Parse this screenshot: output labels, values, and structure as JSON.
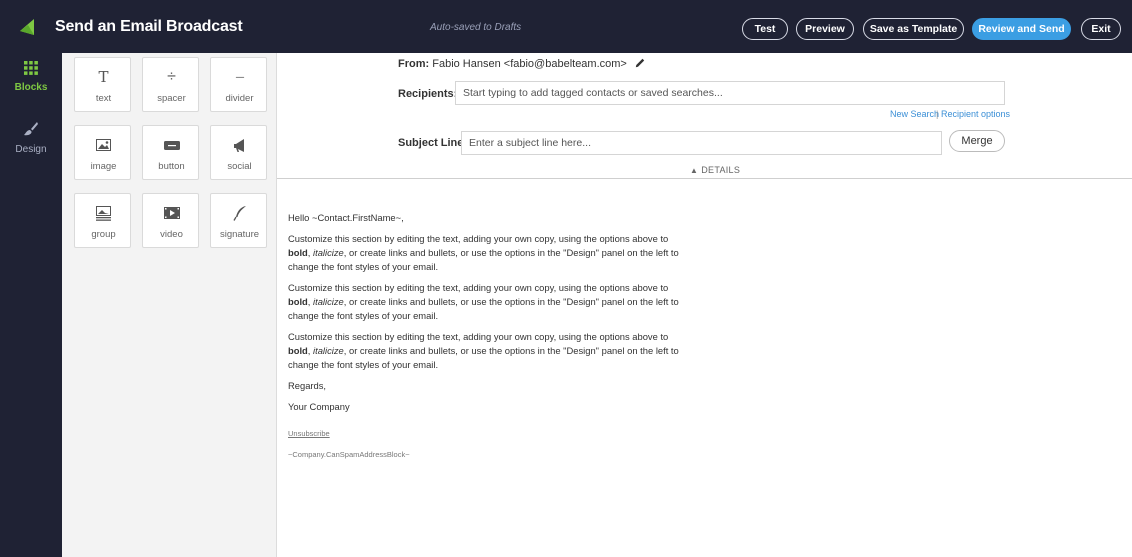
{
  "header": {
    "title": "Send an Email Broadcast",
    "autosave": "Auto-saved to Drafts",
    "buttons": {
      "test": "Test",
      "preview": "Preview",
      "save_template": "Save as Template",
      "review_send": "Review and Send",
      "exit": "Exit"
    },
    "accent": "#3b9ee3"
  },
  "rail": {
    "items": [
      {
        "label": "Blocks",
        "icon": "grid-icon",
        "active": true
      },
      {
        "label": "Design",
        "icon": "paint-brush-icon",
        "active": false
      }
    ],
    "accent": "#7ec843"
  },
  "blocks": {
    "items": [
      {
        "label": "text",
        "icon": "text-icon",
        "glyph": "T"
      },
      {
        "label": "spacer",
        "icon": "spacer-icon",
        "glyph": "÷"
      },
      {
        "label": "divider",
        "icon": "divider-icon",
        "glyph": "----"
      },
      {
        "label": "image",
        "icon": "image-icon",
        "glyph": ""
      },
      {
        "label": "button",
        "icon": "button-icon",
        "glyph": ""
      },
      {
        "label": "social",
        "icon": "megaphone-icon",
        "glyph": ""
      },
      {
        "label": "group",
        "icon": "group-icon",
        "glyph": ""
      },
      {
        "label": "video",
        "icon": "video-icon",
        "glyph": ""
      },
      {
        "label": "signature",
        "icon": "quill-icon",
        "glyph": ""
      }
    ]
  },
  "form": {
    "from_label": "From:",
    "from_value": "Fabio Hansen <fabio@babelteam.com>",
    "recipients_label": "Recipients:",
    "recipients_placeholder": "Start typing to add tagged contacts or saved searches...",
    "new_search": "New Search",
    "separator": "|",
    "recipient_options": "Recipient options",
    "subject_label": "Subject Line:",
    "subject_placeholder": "Enter a subject line here...",
    "merge": "Merge",
    "details": "DETAILS"
  },
  "email": {
    "greeting": "Hello ~Contact.FirstName~,",
    "para_a": "Customize this section by editing the text, adding your own copy, using the options above to ",
    "bold_word": "bold",
    "para_b": ",",
    "italic_word": "italicize",
    "para_c": ", or create links and bullets, or use the options in the \"Design\" panel on the left to change the font styles of your email.",
    "regards": "Regards,",
    "company": "Your Company",
    "unsubscribe": "Unsubscribe",
    "address_block": "~Company.CanSpamAddressBlock~"
  }
}
